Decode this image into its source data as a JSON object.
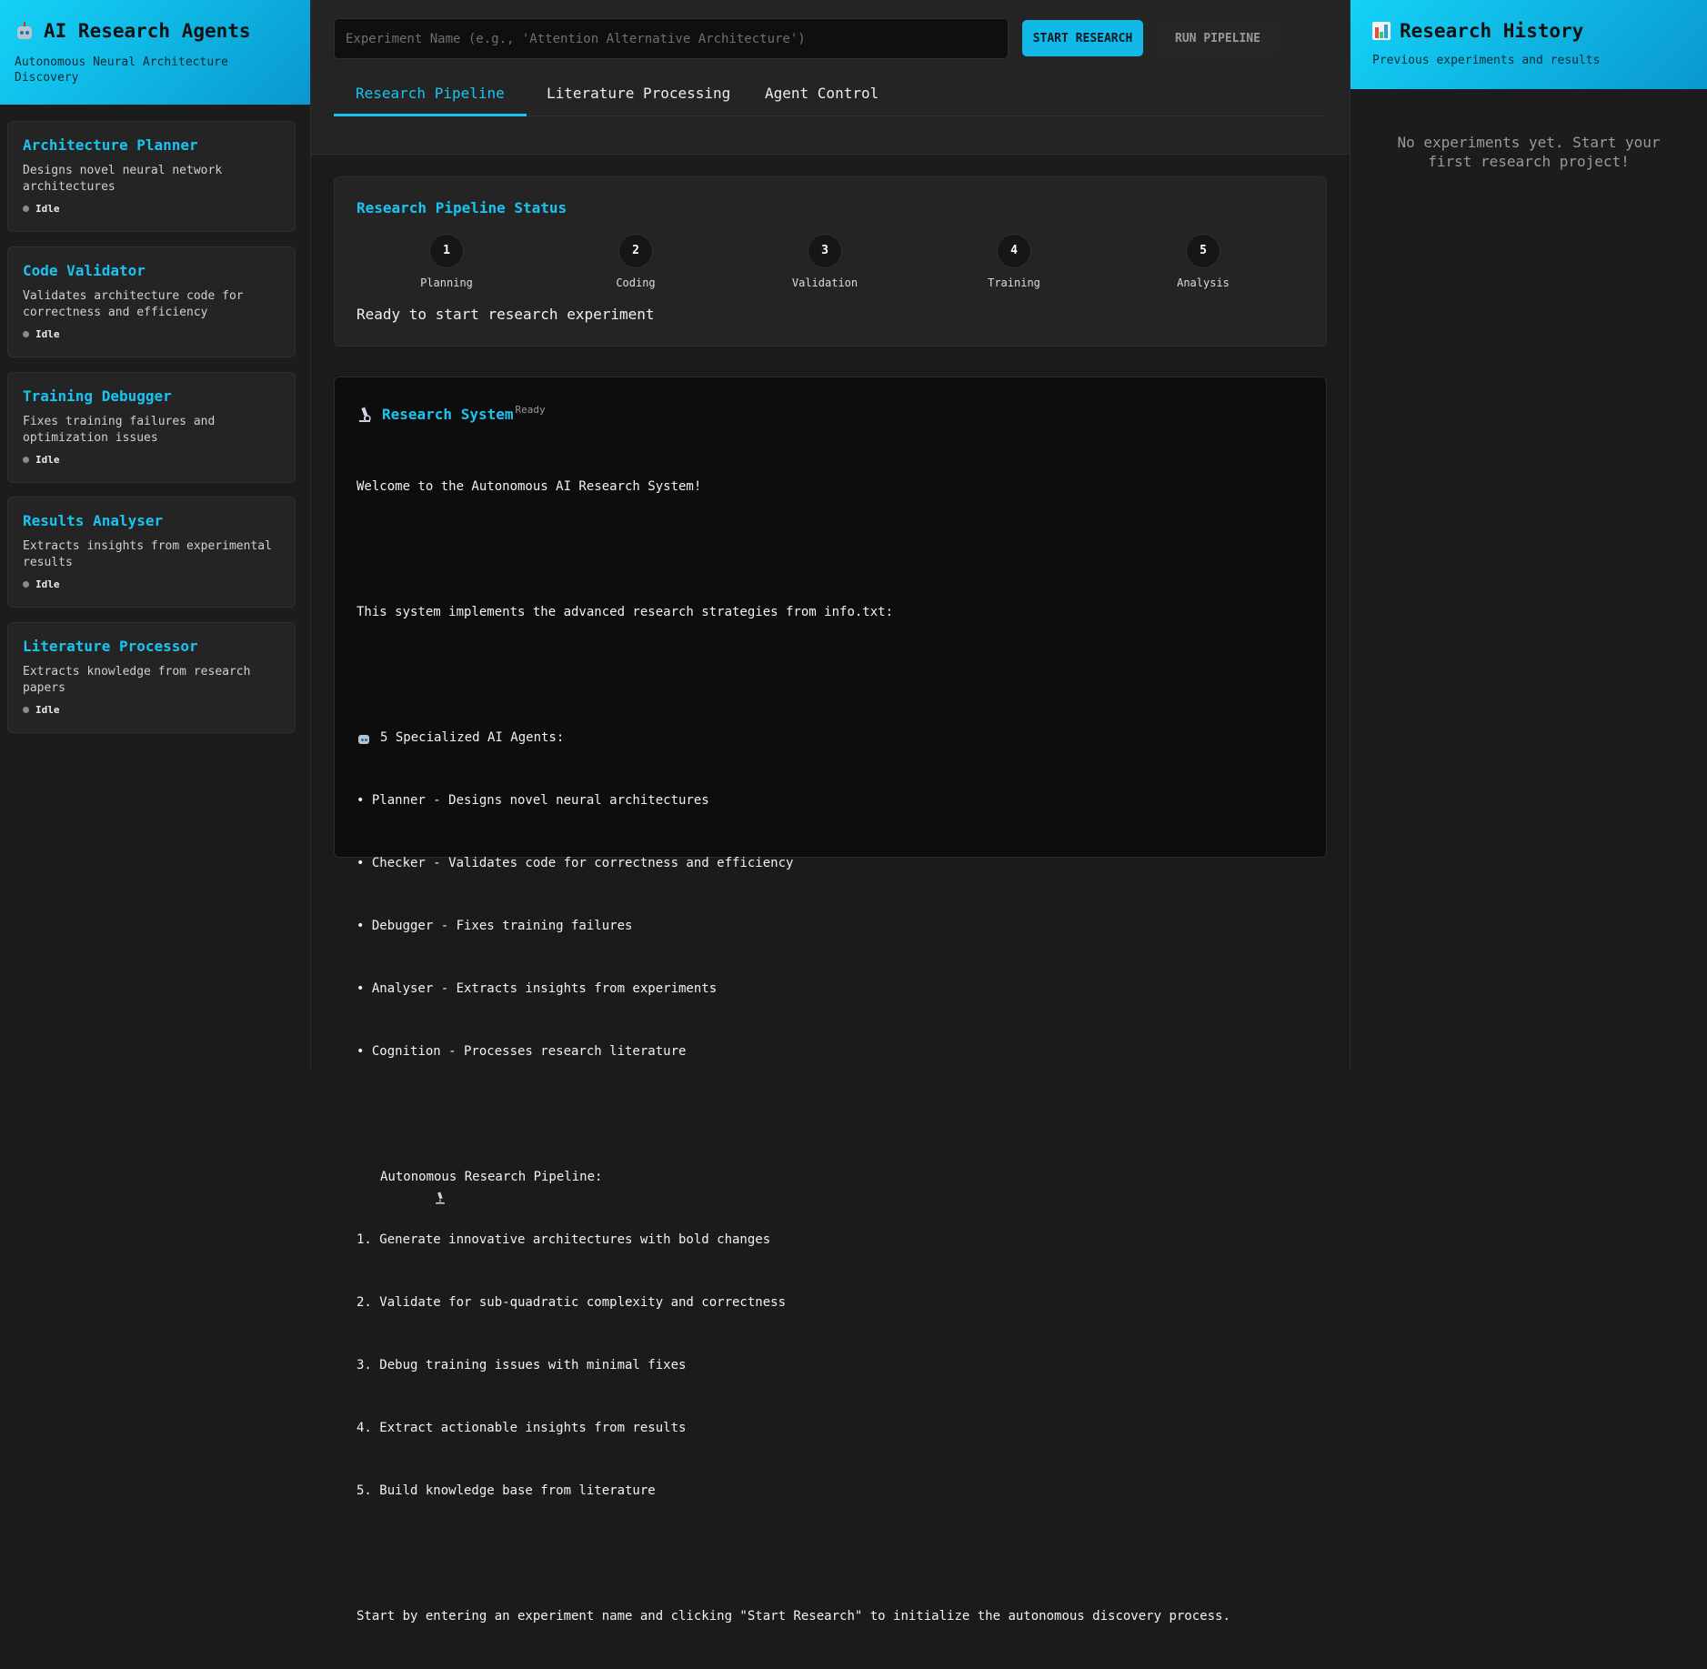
{
  "sidebar": {
    "title": "AI Research Agents",
    "subtitle": "Autonomous Neural Architecture Discovery",
    "agents": [
      {
        "name": "Architecture Planner",
        "desc": "Designs novel neural network architectures",
        "status": "Idle"
      },
      {
        "name": "Code Validator",
        "desc": "Validates architecture code for correctness and efficiency",
        "status": "Idle"
      },
      {
        "name": "Training Debugger",
        "desc": "Fixes training failures and optimization issues",
        "status": "Idle"
      },
      {
        "name": "Results Analyser",
        "desc": "Extracts insights from experimental results",
        "status": "Idle"
      },
      {
        "name": "Literature Processor",
        "desc": "Extracts knowledge from research papers",
        "status": "Idle"
      }
    ]
  },
  "toolbar": {
    "experiment_placeholder": "Experiment Name (e.g., 'Attention Alternative Architecture')",
    "start_label": "START RESEARCH",
    "run_label": "RUN PIPELINE"
  },
  "tabs": [
    {
      "label": "Research Pipeline",
      "active": true
    },
    {
      "label": "Literature Processing",
      "active": false
    },
    {
      "label": "Agent Control",
      "active": false
    }
  ],
  "pipeline": {
    "title": "Research Pipeline Status",
    "steps": [
      {
        "num": "1",
        "label": "Planning"
      },
      {
        "num": "2",
        "label": "Coding"
      },
      {
        "num": "3",
        "label": "Validation"
      },
      {
        "num": "4",
        "label": "Training"
      },
      {
        "num": "5",
        "label": "Analysis"
      }
    ],
    "status": "Ready to start research experiment"
  },
  "console": {
    "title": "Research System",
    "badge": "Ready",
    "lines": [
      "Welcome to the Autonomous AI Research System!",
      "",
      "This system implements the advanced research strategies from info.txt:",
      "",
      "5 Specialized AI Agents:",
      "• Planner - Designs novel neural architectures",
      "• Checker - Validates code for correctness and efficiency",
      "• Debugger - Fixes training failures",
      "• Analyser - Extracts insights from experiments",
      "• Cognition - Processes research literature",
      "",
      "Autonomous Research Pipeline:",
      "1. Generate innovative architectures with bold changes",
      "2. Validate for sub-quadratic complexity and correctness",
      "3. Debug training issues with minimal fixes",
      "4. Extract actionable insights from results",
      "5. Build knowledge base from literature",
      "",
      "Start by entering an experiment name and clicking \"Start Research\" to initialize the autonomous discovery process."
    ]
  },
  "history": {
    "title": "Research History",
    "subtitle": "Previous experiments and results",
    "empty": "No experiments yet. Start your first research project!"
  },
  "colors": {
    "accent": "#19c5f0",
    "header_gradient_start": "#14d2f7",
    "header_gradient_end": "#0a98cf",
    "status_idle": "#8a8a8a"
  },
  "icons": {
    "sidebar": "robot-icon",
    "console": "microscope-icon",
    "history": "bar-chart-icon"
  }
}
